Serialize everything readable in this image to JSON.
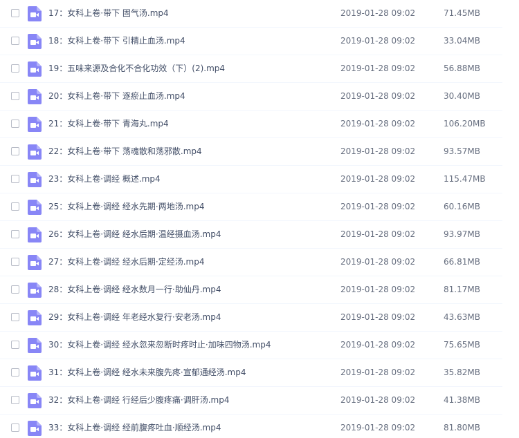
{
  "colors": {
    "icon_background": "#8886f6",
    "icon_glyph": "#ffffff",
    "row_divider": "#f2f6fd"
  },
  "icons": {
    "row_icon": "video-file-icon",
    "checkbox": "checkbox-unchecked"
  },
  "files": [
    {
      "name": "17：女科上卷·带下 固气汤.mp4",
      "date": "2019-01-28 09:02",
      "size": "71.45MB"
    },
    {
      "name": "18：女科上卷·带下 引精止血汤.mp4",
      "date": "2019-01-28 09:02",
      "size": "33.04MB"
    },
    {
      "name": "19：五味来源及合化不合化功效（下）(2).mp4",
      "date": "2019-01-28 09:02",
      "size": "56.88MB"
    },
    {
      "name": "20：女科上卷·带下 逐瘀止血汤.mp4",
      "date": "2019-01-28 09:02",
      "size": "30.40MB"
    },
    {
      "name": "21：女科上卷·带下 青海丸.mp4",
      "date": "2019-01-28 09:02",
      "size": "106.20MB"
    },
    {
      "name": "22：女科上卷·带下 荡魂散和荡邪散.mp4",
      "date": "2019-01-28 09:02",
      "size": "93.57MB"
    },
    {
      "name": "23：女科上卷·调经 概述.mp4",
      "date": "2019-01-28 09:02",
      "size": "115.47MB"
    },
    {
      "name": "25：女科上卷·调经 经水先期·两地汤.mp4",
      "date": "2019-01-28 09:02",
      "size": "60.16MB"
    },
    {
      "name": "26：女科上卷·调经 经水后期·温经摄血汤.mp4",
      "date": "2019-01-28 09:02",
      "size": "93.97MB"
    },
    {
      "name": "27：女科上卷·调经 经水后期·定经汤.mp4",
      "date": "2019-01-28 09:02",
      "size": "66.81MB"
    },
    {
      "name": "28：女科上卷·调经 经水数月一行·助仙丹.mp4",
      "date": "2019-01-28 09:02",
      "size": "81.17MB"
    },
    {
      "name": "29：女科上卷·调经 年老经水复行·安老汤.mp4",
      "date": "2019-01-28 09:02",
      "size": "43.63MB"
    },
    {
      "name": "30：女科上卷·调经 经水忽来忽断时疼时止·加味四物汤.mp4",
      "date": "2019-01-28 09:02",
      "size": "75.65MB"
    },
    {
      "name": "31：女科上卷·调经 经水未来腹先疼·宣郁通经汤.mp4",
      "date": "2019-01-28 09:02",
      "size": "35.82MB"
    },
    {
      "name": "32：女科上卷·调经 行经后少腹疼痛·调肝汤.mp4",
      "date": "2019-01-28 09:02",
      "size": "41.38MB"
    },
    {
      "name": "33：女科上卷·调经 经前腹疼吐血·顺经汤.mp4",
      "date": "2019-01-28 09:02",
      "size": "81.80MB"
    }
  ]
}
